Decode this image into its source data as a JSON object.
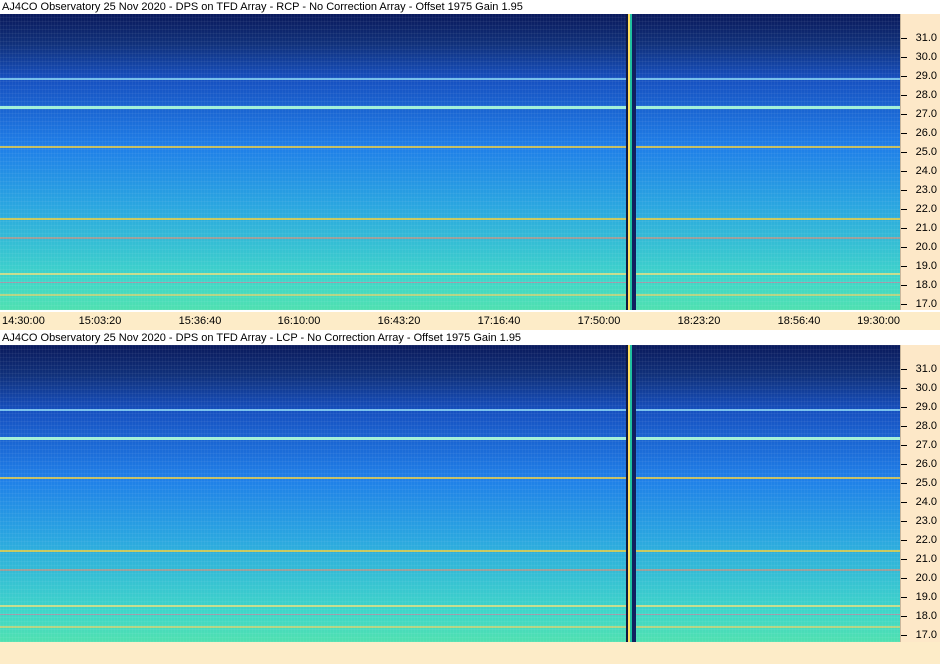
{
  "panels": [
    {
      "title": "AJ4CO Observatory 25 Nov 2020 - DPS on TFD Array  - RCP  -  No Correction Array  -  Offset 1975  Gain 1.95",
      "freq_labels": [
        "31.0",
        "30.0",
        "29.0",
        "28.0",
        "27.0",
        "26.0",
        "25.0",
        "24.0",
        "23.0",
        "22.0",
        "21.0",
        "20.0",
        "19.0",
        "18.0",
        "17.0"
      ],
      "time_labels": [
        "14:30:00",
        "15:03:20",
        "15:36:40",
        "16:10:00",
        "16:43:20",
        "17:16:40",
        "17:50:00",
        "18:23:20",
        "18:56:40",
        "19:30:00"
      ]
    },
    {
      "title": "AJ4CO Observatory 25 Nov 2020 - DPS on TFD Array  - LCP  -  No Correction Array  -  Offset 1975  Gain 1.95",
      "freq_labels": [
        "31.0",
        "30.0",
        "29.0",
        "28.0",
        "27.0",
        "26.0",
        "25.0",
        "24.0",
        "23.0",
        "22.0",
        "21.0",
        "20.0",
        "19.0",
        "18.0",
        "17.0"
      ]
    }
  ],
  "colors": {
    "axis_background": "#fde8c8",
    "spectrogram_low": "#0a1a5c",
    "spectrogram_mid": "#1f7fe8",
    "spectrogram_high": "#3fd6c8",
    "interference_line": "#f0d040"
  }
}
